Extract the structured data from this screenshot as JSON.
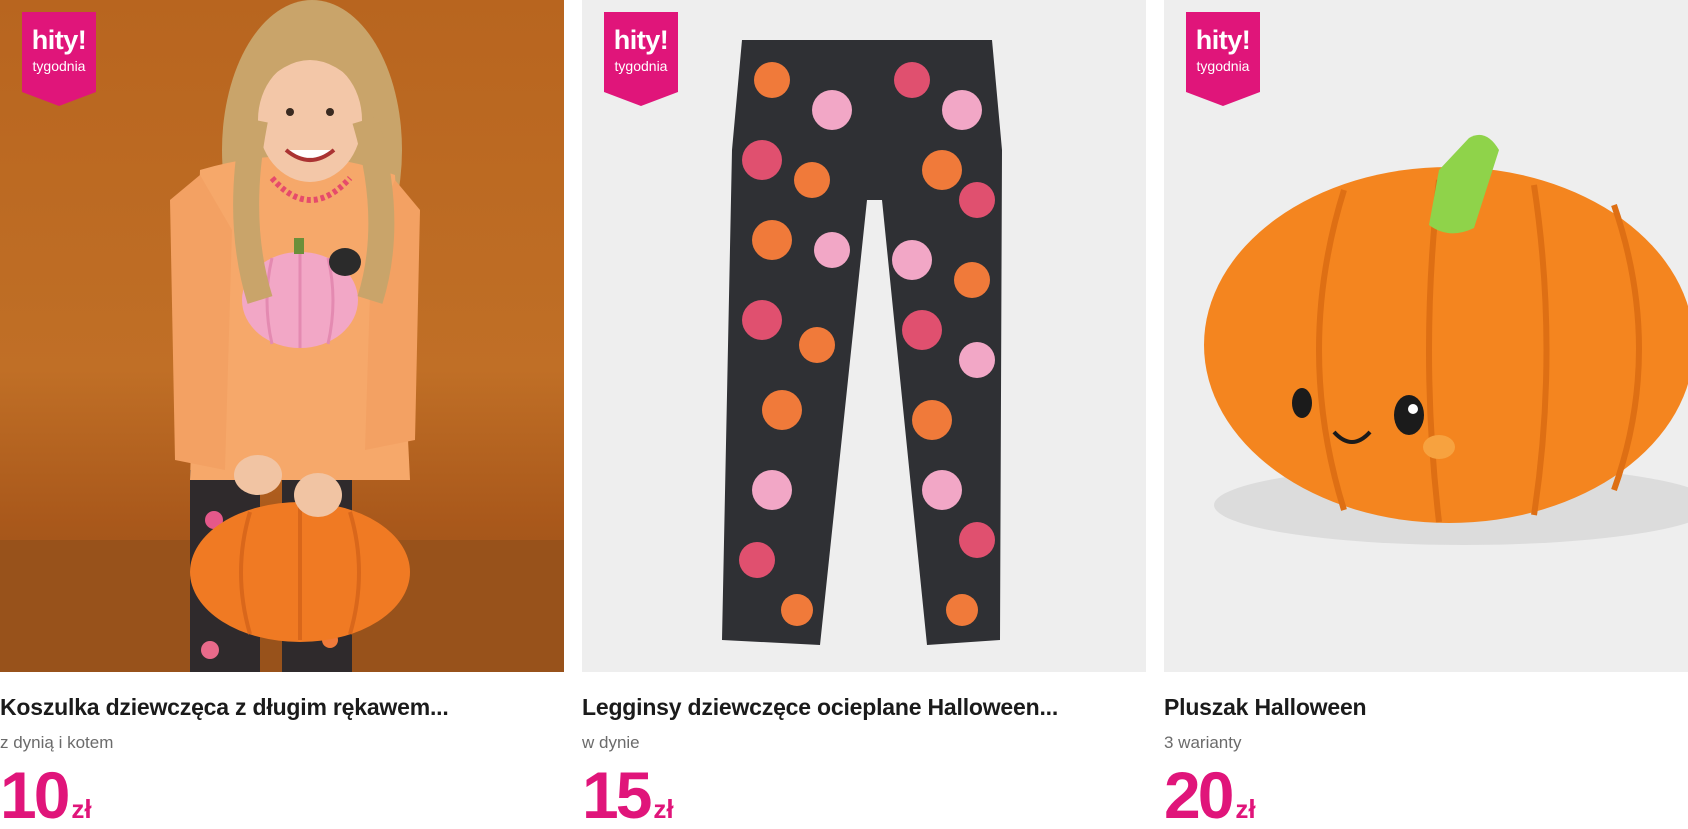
{
  "colors": {
    "accent": "#e0157a",
    "title": "#1b1b1b",
    "subtitle": "#6b6b6b"
  },
  "products": [
    {
      "badge": {
        "top": "hity!",
        "bottom": "tygodnia"
      },
      "title": "Koszulka dziewczęca z długim rękawem...",
      "subtitle": "z dynią i kotem",
      "price": {
        "amount": "10",
        "currency": "zł"
      },
      "image_icon": "girl-with-pumpkin-photo"
    },
    {
      "badge": {
        "top": "hity!",
        "bottom": "tygodnia"
      },
      "title": "Legginsy dziewczęce ocieplane Halloween...",
      "subtitle": "w dynie",
      "price": {
        "amount": "15",
        "currency": "zł"
      },
      "image_icon": "pumpkin-leggings-photo"
    },
    {
      "badge": {
        "top": "hity!",
        "bottom": "tygodnia"
      },
      "title": "Pluszak Halloween",
      "subtitle": "3 warianty",
      "price": {
        "amount": "20",
        "currency": "zł"
      },
      "image_icon": "pumpkin-plush-photo"
    }
  ]
}
